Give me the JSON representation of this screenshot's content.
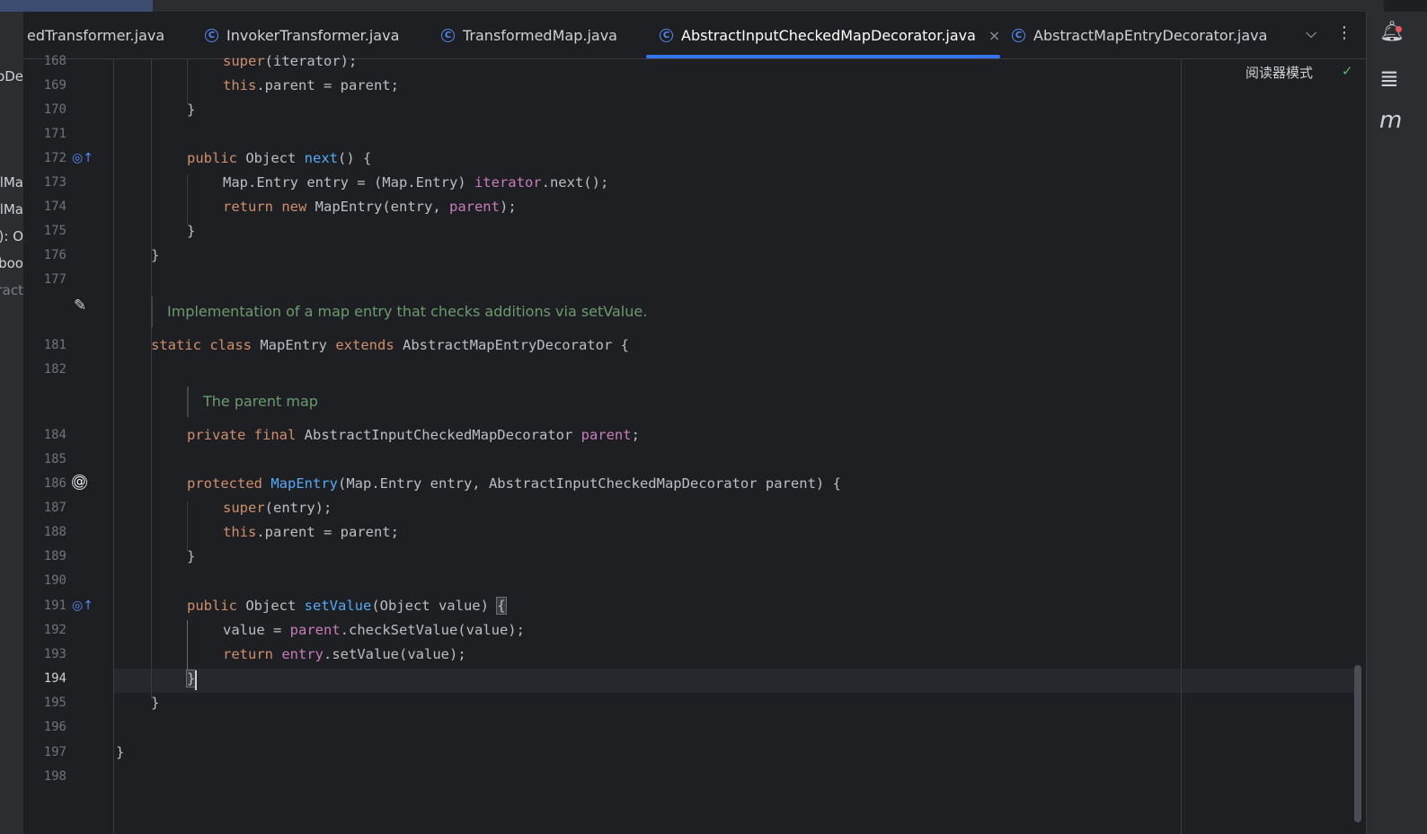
{
  "left_panel": {
    "fragments": [
      "pDe",
      "lMa",
      "lMa",
      "): O",
      " boo",
      "ract"
    ]
  },
  "tabs": [
    {
      "label": "edTransformer.java",
      "has_icon": false
    },
    {
      "label": "InvokerTransformer.java",
      "has_icon": true
    },
    {
      "label": "TransformedMap.java",
      "has_icon": true
    },
    {
      "label": "AbstractInputCheckedMapDecorator.java",
      "has_icon": true,
      "active": true
    },
    {
      "label": "AbstractMapEntryDecorator.java",
      "has_icon": true
    }
  ],
  "tab_icon_glyph": "C",
  "tab_close_glyph": "×",
  "tab_chevron_glyph": "⌵",
  "tab_menu_glyph": "⋮",
  "reader_mode_label": "阅读器模式",
  "reader_check_glyph": "✓",
  "right_toolbar_icons": [
    "bell-icon",
    "database-icon",
    "maven-icon"
  ],
  "right_toolbar_glyphs": {
    "bell": "🔔︎",
    "database": "≣",
    "maven": "m"
  },
  "gutter_glyphs": {
    "override": "◎↑",
    "edit": "✎",
    "at": "@"
  },
  "line_numbers": [
    "168",
    "169",
    "170",
    "171",
    "172",
    "173",
    "174",
    "175",
    "176",
    "177",
    "181",
    "182",
    "184",
    "185",
    "186",
    "187",
    "188",
    "189",
    "190",
    "191",
    "192",
    "193",
    "194",
    "195",
    "196",
    "197",
    "198"
  ],
  "current_line": "194",
  "doc_comments": {
    "map_entry": "Implementation of a map entry that checks additions via setValue.",
    "parent_map": "The parent map"
  },
  "code_tokens": {
    "super": "super",
    "iterator_arg": "(iterator);",
    "this": "this",
    "parent_assign": ".parent = parent;",
    "close_brace": "}",
    "public": "public",
    "object": " Object ",
    "next": "next",
    "next_sig": "() {",
    "map_entry_line": "Map.Entry entry = (Map.Entry) ",
    "iterator": "iterator",
    "next_call": ".next();",
    "return": "return",
    "new": " new ",
    "map_entry_ctor": "MapEntry(entry, ",
    "parent": "parent",
    "close_paren_semi": ");",
    "static": "static",
    "class": " class ",
    "map_entry_name": "MapEntry ",
    "extends": "extends",
    "extends_target": " AbstractMapEntryDecorator {",
    "private": "private",
    "final": " final ",
    "field_type": "AbstractInputCheckedMapDecorator ",
    "semi": ";",
    "protected": "protected",
    "ctor_name": "MapEntry",
    "ctor_params": "(Map.Entry entry, AbstractInputCheckedMapDecorator parent) {",
    "entry_arg": "(entry);",
    "set_value": "setValue",
    "set_value_sig": "(Object value) ",
    "open_brace": "{",
    "value_assign": "value = ",
    "check_call": ".checkSetValue(value);",
    "entry": "entry",
    "set_value_call": ".setValue(value);"
  },
  "colors": {
    "keyword": "#cf8e6d",
    "field": "#c77dbb",
    "function": "#56a8f5",
    "doc": "#6c9a70",
    "accent": "#3574f0"
  }
}
